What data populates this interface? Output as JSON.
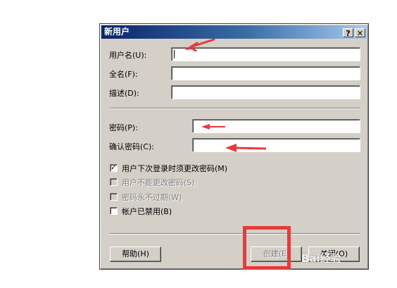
{
  "dialog": {
    "title": "新用户",
    "help_glyph": "?",
    "close_glyph": "✕"
  },
  "form": {
    "username_label": "用户名(U):",
    "username_value": "",
    "fullname_label": "全名(F):",
    "fullname_value": "",
    "description_label": "描述(D):",
    "description_value": "",
    "password_label": "密码(P):",
    "password_value": "",
    "confirm_label": "确认密码(C):",
    "confirm_value": ""
  },
  "options": [
    {
      "label": "用户下次登录时须更改密码(M)",
      "checked": true,
      "enabled": true
    },
    {
      "label": "用户不能更改密码(S)",
      "checked": false,
      "enabled": false
    },
    {
      "label": "密码永不过期(W)",
      "checked": false,
      "enabled": false
    },
    {
      "label": "帐户已禁用(B)",
      "checked": false,
      "enabled": true
    }
  ],
  "buttons": {
    "help": "帮助(H)",
    "create": "创建(E)",
    "close": "关闭(O)"
  },
  "annotation_color": "#e83a3a",
  "watermark": "Bai经验"
}
